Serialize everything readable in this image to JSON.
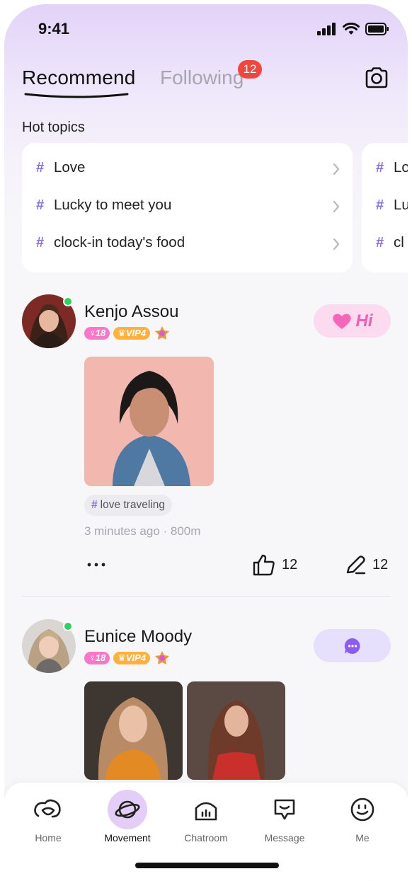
{
  "status_bar": {
    "time": "9:41"
  },
  "header": {
    "tabs": [
      {
        "label": "Recommend",
        "active": true
      },
      {
        "label": "Following",
        "active": false,
        "badge": "12"
      }
    ]
  },
  "hot_topics": {
    "title": "Hot topics",
    "card_1": [
      "Love",
      "Lucky to meet you",
      "clock-in today's food"
    ],
    "card_2": [
      "Lo",
      "Lu",
      "cl"
    ]
  },
  "posts": [
    {
      "username": "Kenjo Assou",
      "age": "18",
      "vip": "VIP4",
      "action": "Hi",
      "topic": "love traveling",
      "meta": "3 minutes ago · 800m",
      "likes": "12",
      "comments": "12"
    },
    {
      "username": "Eunice Moody",
      "age": "18",
      "vip": "VIP4"
    }
  ],
  "nav": {
    "items": [
      {
        "label": "Home",
        "icon": "home-icon"
      },
      {
        "label": "Movement",
        "icon": "planet-icon",
        "active": true
      },
      {
        "label": "Chatroom",
        "icon": "chatroom-icon"
      },
      {
        "label": "Message",
        "icon": "message-icon"
      },
      {
        "label": "Me",
        "icon": "smiley-icon"
      }
    ]
  },
  "colors": {
    "accent": "#8a6ee8",
    "badge": "#f0463c",
    "online": "#2fd25a",
    "hi_button": "#fcdaf0",
    "nav_active": "#e4cdf6"
  }
}
